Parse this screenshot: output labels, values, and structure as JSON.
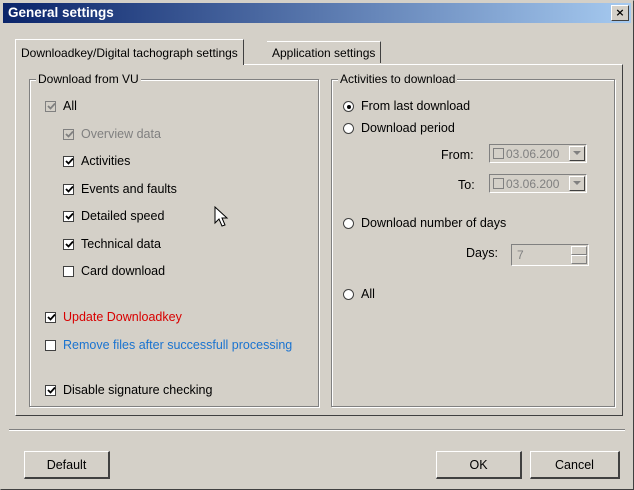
{
  "window": {
    "title": "General settings",
    "close_glyph": "×"
  },
  "tabs": [
    {
      "label": "Downloadkey/Digital tachograph settings",
      "active": true
    },
    {
      "label": "Application settings",
      "active": false
    }
  ],
  "download_group": {
    "title": "Download from VU",
    "items": [
      {
        "label": "All",
        "checked": true,
        "enabled": false
      },
      {
        "label": "Overview data",
        "checked": true,
        "enabled": false
      },
      {
        "label": "Activities",
        "checked": true,
        "enabled": true
      },
      {
        "label": "Events and faults",
        "checked": true,
        "enabled": true
      },
      {
        "label": "Detailed speed",
        "checked": true,
        "enabled": true
      },
      {
        "label": "Technical data",
        "checked": true,
        "enabled": true
      },
      {
        "label": "Card download",
        "checked": false,
        "enabled": true
      },
      {
        "label": "Update Downloadkey",
        "checked": true,
        "enabled": true,
        "color": "#d80000"
      },
      {
        "label": "Remove files after successfull processing",
        "checked": false,
        "enabled": true,
        "color": "#1a73d0"
      },
      {
        "label": "Disable signature checking",
        "checked": true,
        "enabled": true
      }
    ]
  },
  "activities_group": {
    "title": "Activities to download",
    "radios": [
      {
        "label": "From last download",
        "selected": true
      },
      {
        "label": "Download period",
        "selected": false
      },
      {
        "label": "Download number of days",
        "selected": false
      },
      {
        "label": "All",
        "selected": false
      }
    ],
    "from_label": "From:",
    "from_value": "03.06.200",
    "to_label": "To:",
    "to_value": "03.06.200",
    "days_label": "Days:",
    "days_value": "7"
  },
  "buttons": {
    "default": "Default",
    "ok": "OK",
    "cancel": "Cancel"
  },
  "colors": {
    "face": "#d4d0c8",
    "title_start": "#0a246a",
    "title_end": "#a6caf0"
  }
}
